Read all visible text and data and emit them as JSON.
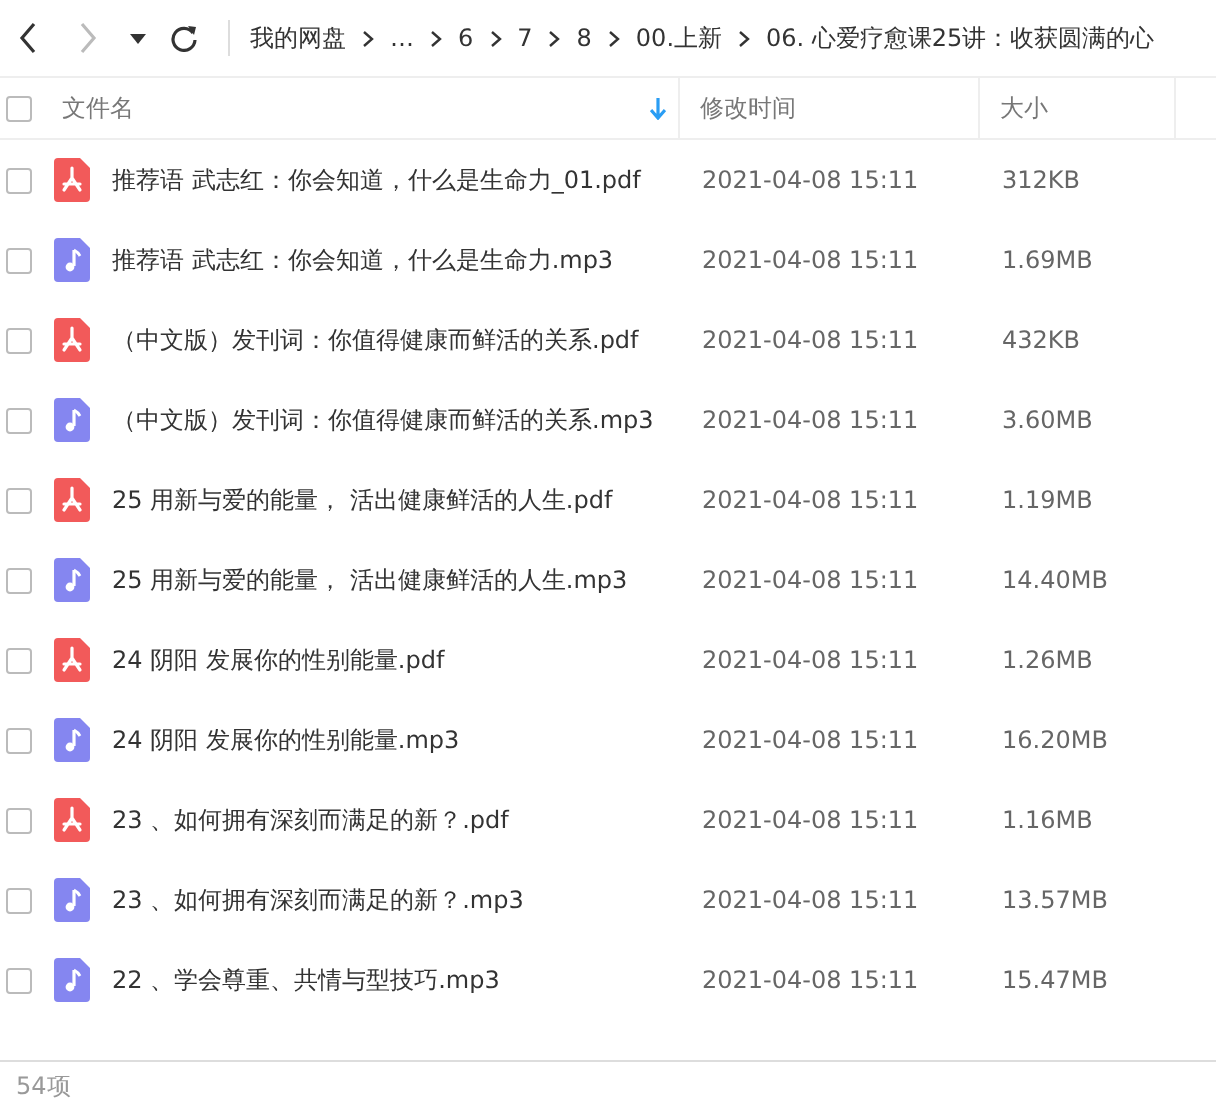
{
  "nav": {
    "back_disabled": false,
    "forward_disabled": true
  },
  "breadcrumb": [
    "我的网盘",
    "…",
    "6",
    "7",
    "8",
    "00.上新",
    "06. 心爱疗愈课25讲：收获圆满的心"
  ],
  "columns": [
    {
      "label": "文件名",
      "sorted": true
    },
    {
      "label": "修改时间",
      "sorted": false
    },
    {
      "label": "大小",
      "sorted": false
    }
  ],
  "select_all": {
    "checked": false
  },
  "rows": [
    {
      "kind": "pdf",
      "name": "推荐语   武志红：你会知道，什么是生命力_01.pdf",
      "modified": "2021-04-08 15:11",
      "size": "312KB",
      "checked": false
    },
    {
      "kind": "mp3",
      "name": "推荐语   武志红：你会知道，什么是生命力.mp3",
      "modified": "2021-04-08 15:11",
      "size": "1.69MB",
      "checked": false
    },
    {
      "kind": "pdf",
      "name": "（中文版）发刊词：你值得健康而鲜活的关系.pdf",
      "modified": "2021-04-08 15:11",
      "size": "432KB",
      "checked": false
    },
    {
      "kind": "mp3",
      "name": "（中文版）发刊词：你值得健康而鲜活的关系.mp3",
      "modified": "2021-04-08 15:11",
      "size": "3.60MB",
      "checked": false
    },
    {
      "kind": "pdf",
      "name": "25 用新与爱的能量， 活出健康鲜活的人生.pdf",
      "modified": "2021-04-08 15:11",
      "size": "1.19MB",
      "checked": false
    },
    {
      "kind": "mp3",
      "name": "25 用新与爱的能量， 活出健康鲜活的人生.mp3",
      "modified": "2021-04-08 15:11",
      "size": "14.40MB",
      "checked": false
    },
    {
      "kind": "pdf",
      "name": "24 阴阳  发展你的性别能量.pdf",
      "modified": "2021-04-08 15:11",
      "size": "1.26MB",
      "checked": false
    },
    {
      "kind": "mp3",
      "name": "24 阴阳  发展你的性别能量.mp3",
      "modified": "2021-04-08 15:11",
      "size": "16.20MB",
      "checked": false
    },
    {
      "kind": "pdf",
      "name": "23 、如何拥有深刻而满足的新？.pdf",
      "modified": "2021-04-08 15:11",
      "size": "1.16MB",
      "checked": false
    },
    {
      "kind": "mp3",
      "name": "23 、如何拥有深刻而满足的新？.mp3",
      "modified": "2021-04-08 15:11",
      "size": "13.57MB",
      "checked": false
    },
    {
      "kind": "mp3",
      "name": "22 、学会尊重、共情与型技巧.mp3",
      "modified": "2021-04-08 15:11",
      "size": "15.47MB",
      "checked": false
    }
  ],
  "status_bar": "54项"
}
